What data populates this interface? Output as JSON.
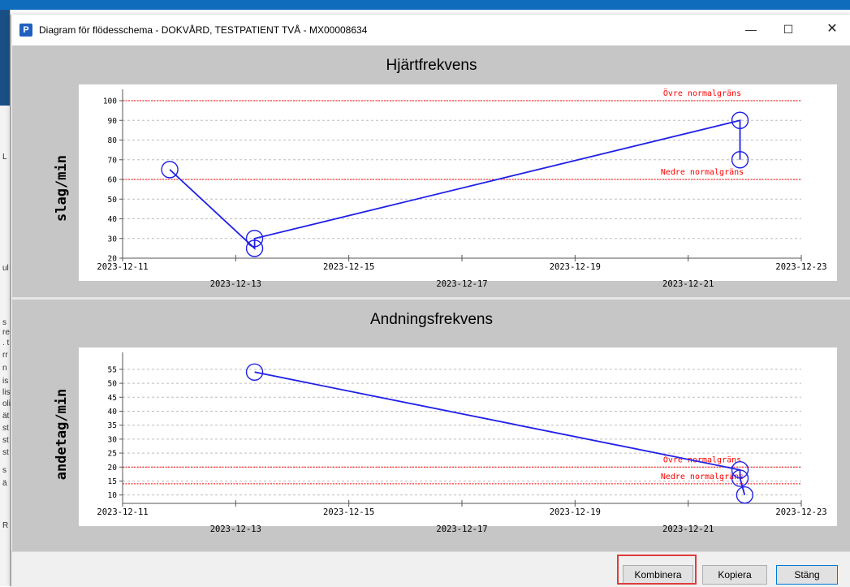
{
  "window": {
    "title": "Diagram för flödesschema - DOKVÅRD, TESTPATIENT TVÅ - MX00008634",
    "app_icon": "P",
    "min_label": "—",
    "max_label": "☐",
    "close_label": "✕"
  },
  "background_fragments": [
    "L",
    "ul",
    "s",
    "re",
    ". t",
    "rr",
    "n",
    "is",
    "lis",
    "oli",
    "ät",
    "st",
    "st",
    "st",
    "s",
    "ä",
    "R"
  ],
  "buttons": {
    "kombinera": "Kombinera",
    "kopiera": "Kopiera",
    "stang": "Stäng"
  },
  "colors": {
    "series": "#2020e8",
    "limit": "#ff0000",
    "panel": "#c6c6c6",
    "highlight": "#e03c3c"
  },
  "chart_data": [
    {
      "type": "line",
      "title": "Hjärtfrekvens",
      "ylabel": "slag/min",
      "xlabel": "",
      "x_ticks": [
        "2023-12-11",
        "2023-12-13",
        "2023-12-15",
        "2023-12-17",
        "2023-12-19",
        "2023-12-21",
        "2023-12-23"
      ],
      "xlim": [
        "2023-12-11",
        "2023-12-23"
      ],
      "ylim": [
        20,
        100
      ],
      "y_ticks": [
        20,
        30,
        40,
        50,
        60,
        70,
        80,
        90,
        100
      ],
      "grid": true,
      "series": [
        {
          "points": [
            {
              "x": "2023-12-11T20:00",
              "y": 65
            },
            {
              "x": "2023-12-13T08:00",
              "y": 25
            },
            {
              "x": "2023-12-13T08:00",
              "y": 30
            },
            {
              "x": "2023-12-21T22:00",
              "y": 90
            },
            {
              "x": "2023-12-21T22:00",
              "y": 70
            }
          ],
          "line_order": [
            [
              0,
              1
            ],
            [
              1,
              2
            ],
            [
              2,
              3
            ],
            [
              3,
              4
            ]
          ]
        }
      ],
      "limits": [
        {
          "label": "Övre normalgräns",
          "y": 100
        },
        {
          "label": "Nedre normalgräns",
          "y": 60
        }
      ]
    },
    {
      "type": "line",
      "title": "Andningsfrekvens",
      "ylabel": "andetag/min",
      "xlabel": "",
      "x_ticks": [
        "2023-12-11",
        "2023-12-13",
        "2023-12-15",
        "2023-12-17",
        "2023-12-19",
        "2023-12-21",
        "2023-12-23"
      ],
      "xlim": [
        "2023-12-11",
        "2023-12-23"
      ],
      "ylim": [
        7,
        57
      ],
      "y_ticks": [
        10,
        15,
        20,
        25,
        30,
        35,
        40,
        45,
        50,
        55
      ],
      "grid": true,
      "series": [
        {
          "points": [
            {
              "x": "2023-12-13T08:00",
              "y": 54
            },
            {
              "x": "2023-12-21T22:00",
              "y": 19
            },
            {
              "x": "2023-12-21T22:00",
              "y": 16
            },
            {
              "x": "2023-12-22T00:00",
              "y": 10
            }
          ]
        }
      ],
      "limits": [
        {
          "label": "Övre normalgräns",
          "y": 20
        },
        {
          "label": "Nedre normalgräns",
          "y": 14
        }
      ]
    }
  ]
}
